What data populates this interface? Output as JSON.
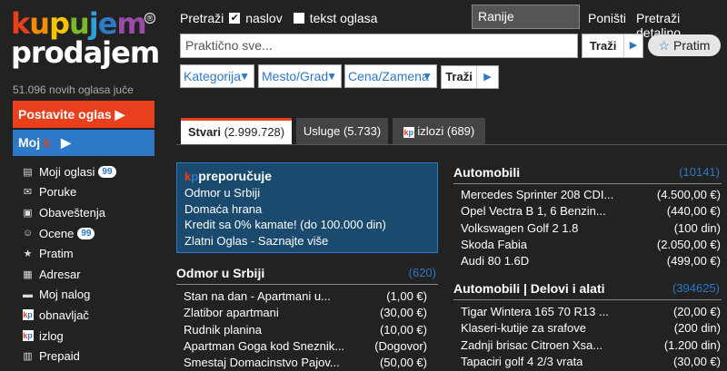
{
  "logo": {
    "line1": [
      {
        "ch": "k",
        "color": "#e8401c"
      },
      {
        "ch": "u",
        "color": "#f28c00"
      },
      {
        "ch": "p",
        "color": "#f5c400"
      },
      {
        "ch": "u",
        "color": "#7ab929"
      },
      {
        "ch": "j",
        "color": "#2e9fd9"
      },
      {
        "ch": "e",
        "color": "#2e78c8"
      },
      {
        "ch": "m",
        "color": "#9b4aa8"
      }
    ],
    "line2": "prodajem",
    "reg": "®"
  },
  "stats": "51.096 novih oglasa juče",
  "post_ad": "Postavite oglas ▶",
  "moj": {
    "label": "Moj",
    "arrow": "▶",
    "k": "k",
    "p": "p"
  },
  "sidebar": [
    {
      "label": "Moji oglasi",
      "badge": "99",
      "icon": "ads-icon"
    },
    {
      "label": "Poruke",
      "badge": "",
      "icon": "envelope-icon"
    },
    {
      "label": "Obaveštenja",
      "badge": "",
      "icon": "notification-icon"
    },
    {
      "label": "Ocene",
      "badge": "99",
      "icon": "rating-icon"
    },
    {
      "label": "Pratim",
      "badge": "",
      "icon": "star-icon"
    },
    {
      "label": "Adresar",
      "badge": "",
      "icon": "address-book-icon"
    },
    {
      "label": "Moj nalog",
      "badge": "",
      "icon": "account-icon"
    },
    {
      "label": "obnavljač",
      "badge": "",
      "icon": "kp-icon"
    },
    {
      "label": "izlog",
      "badge": "",
      "icon": "kp-icon"
    },
    {
      "label": "Prepaid",
      "badge": "",
      "icon": "wallet-icon"
    }
  ],
  "search": {
    "pretrazi": "Pretraži",
    "naslov": "naslov",
    "naslov_checked": true,
    "tekst": "tekst oglasa",
    "tekst_checked": false,
    "ranije": "Ranije pretrage",
    "ponisti": "Poništi",
    "detaljno": "Pretraži detaljno",
    "placeholder": "Praktično sve...",
    "trazi": "Traži",
    "pratim": "Pratim"
  },
  "filters": {
    "kategorija": "Kategorija",
    "mesto": "Mesto/Grad",
    "cena": "Cena/Zamena",
    "trazi": "Traži"
  },
  "tabs": [
    {
      "label": "Stvari",
      "count": "(2.999.728)",
      "active": true
    },
    {
      "label": "Usluge",
      "count": "(5.733)",
      "active": false
    },
    {
      "label": "izlozi",
      "count": "(689)",
      "active": false
    }
  ],
  "preporucuje": {
    "title": "preporučuje",
    "items": [
      "Odmor u Srbiji",
      "Domaća hrana",
      "Kredit sa 0% kamate! (do 100.000 din)",
      "Zlatni Oglas - Saznajte više"
    ]
  },
  "categories": {
    "odmor": {
      "title": "Odmor u Srbiji",
      "count": "(620)",
      "rows": [
        {
          "t": "Stan na dan - Apartmani u...",
          "p": "(1,00 €)"
        },
        {
          "t": "Zlatibor apartmani",
          "p": "(30,00 €)"
        },
        {
          "t": "Rudnik planina",
          "p": "(10,00 €)"
        },
        {
          "t": "Apartman Goga kod Sneznik...",
          "p": "(Dogovor)"
        },
        {
          "t": "Smestaj Domacinstvo Pajov...",
          "p": "(50,00 €)"
        }
      ]
    },
    "automobili": {
      "title": "Automobili",
      "count": "(10141)",
      "rows": [
        {
          "t": "Mercedes Sprinter 208 CDI...",
          "p": "(4.500,00 €)"
        },
        {
          "t": "Opel Vectra B 1, 6 Benzin...",
          "p": "(440,00 €)"
        },
        {
          "t": "Volkswagen Golf 2 1.8",
          "p": "(100 din)"
        },
        {
          "t": "Skoda Fabia",
          "p": "(2.050,00 €)"
        },
        {
          "t": "Audi 80 1.6D",
          "p": "(499,00 €)"
        }
      ]
    },
    "delovi": {
      "title": "Automobili | Delovi i alati",
      "count": "(394625)",
      "rows": [
        {
          "t": "Tigar Wintera 165 70 R13 ...",
          "p": "(20,00 €)"
        },
        {
          "t": "Klaseri-kutije za srafove",
          "p": "(200 din)"
        },
        {
          "t": "Zadnji brisac Citroen Xsa...",
          "p": "(1.200 din)"
        },
        {
          "t": "Tapaciri golf 4 2/3 vrata",
          "p": "(30,00 €)"
        }
      ]
    }
  },
  "colors": {
    "accent_red": "#e8401c",
    "accent_blue": "#2e78c8",
    "background": "#222222"
  }
}
